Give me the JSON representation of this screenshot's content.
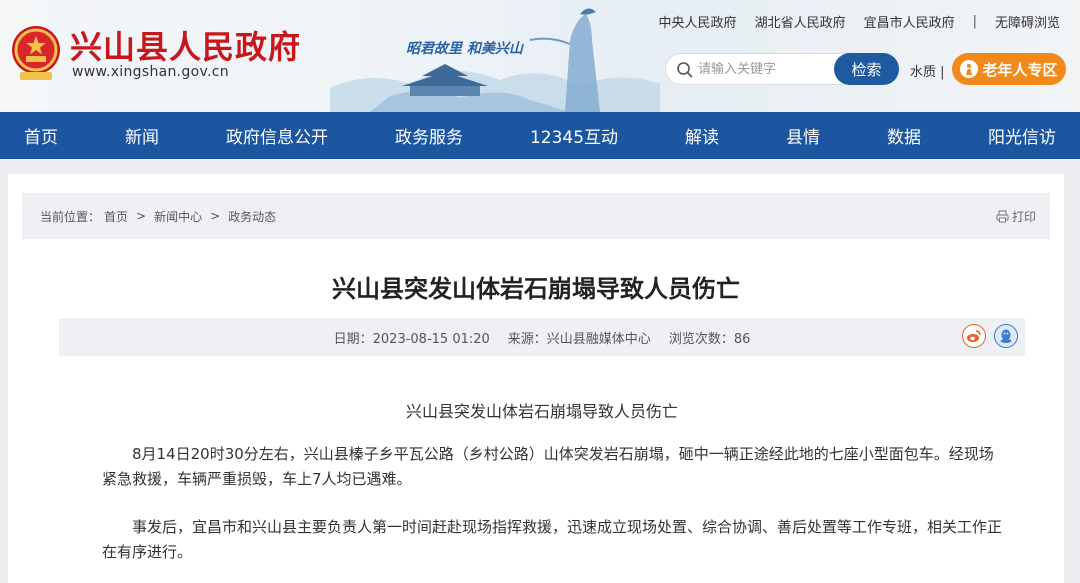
{
  "site": {
    "title": "兴山县人民政府",
    "url": "www.xingshan.gov.cn",
    "slogan": "昭君故里  和美兴山"
  },
  "toplinks": [
    "中央人民政府",
    "湖北省人民政府",
    "宜昌市人民政府",
    "|",
    "无障碍浏览"
  ],
  "search": {
    "placeholder": "请输入关键字",
    "button": "检索"
  },
  "shuizhi": "水质 |",
  "elder": "老年人专区",
  "nav": [
    "首页",
    "新闻",
    "政府信息公开",
    "政务服务",
    "12345互动",
    "解读",
    "县情",
    "数据",
    "阳光信访"
  ],
  "breadcrumb": {
    "label": "当前位置：",
    "items": [
      "首页",
      ">",
      "新闻中心",
      ">",
      "政务动态"
    ]
  },
  "print": "打印",
  "article": {
    "title": "兴山县突发山体岩石崩塌导致人员伤亡",
    "date": "日期：2023-08-15 01:20",
    "source": "来源：兴山县融媒体中心",
    "views": "浏览次数：86",
    "subheading": "兴山县突发山体岩石崩塌导致人员伤亡",
    "paragraphs": [
      "8月14日20时30分左右，兴山县榛子乡平瓦公路（乡村公路）山体突发岩石崩塌，砸中一辆正途经此地的七座小型面包车。经现场紧急救援，车辆严重损毁，车上7人均已遇难。",
      "事发后，宜昌市和兴山县主要负责人第一时间赶赴现场指挥救援，迅速成立现场处置、综合协调、善后处置等工作专班，相关工作正在有序进行。"
    ]
  },
  "colors": {
    "brand_red": "#c8161d",
    "nav_blue": "#1c56a0",
    "elder_orange": "#f28a1b"
  }
}
